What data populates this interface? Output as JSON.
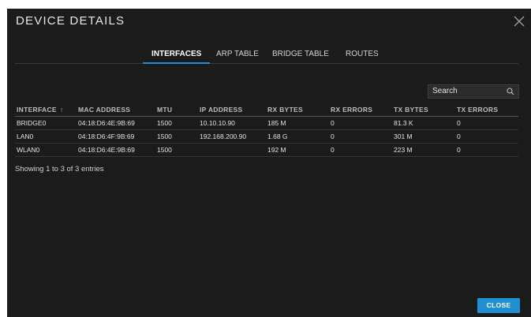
{
  "dialog": {
    "title": "DEVICE DETAILS"
  },
  "tabs": [
    {
      "label": "INTERFACES",
      "active": true
    },
    {
      "label": "ARP TABLE",
      "active": false
    },
    {
      "label": "BRIDGE TABLE",
      "active": false
    },
    {
      "label": "ROUTES",
      "active": false
    }
  ],
  "search": {
    "placeholder": "Search",
    "icon": "search-icon"
  },
  "table": {
    "headers": [
      "INTERFACE",
      "MAC ADDRESS",
      "MTU",
      "IP ADDRESS",
      "RX BYTES",
      "RX ERRORS",
      "TX BYTES",
      "TX ERRORS"
    ],
    "sort_indicator": "↑",
    "rows": [
      [
        "BRIDGE0",
        "04:18:D6:4E:9B:69",
        "1500",
        "10.10.10.90",
        "185 M",
        "0",
        "81.3 K",
        "0"
      ],
      [
        "LAN0",
        "04:18:D6:4F:9B:69",
        "1500",
        "192.168.200.90",
        "1.68 G",
        "0",
        "301 M",
        "0"
      ],
      [
        "WLAN0",
        "04:18:D6:4E:9B:69",
        "1500",
        "",
        "192 M",
        "0",
        "223 M",
        "0"
      ]
    ]
  },
  "footer": {
    "info": "Showing 1 to 3 of 3 entries",
    "close_label": "CLOSE"
  },
  "colors": {
    "accent": "#1e8fd1",
    "background": "#1b1b1b"
  }
}
